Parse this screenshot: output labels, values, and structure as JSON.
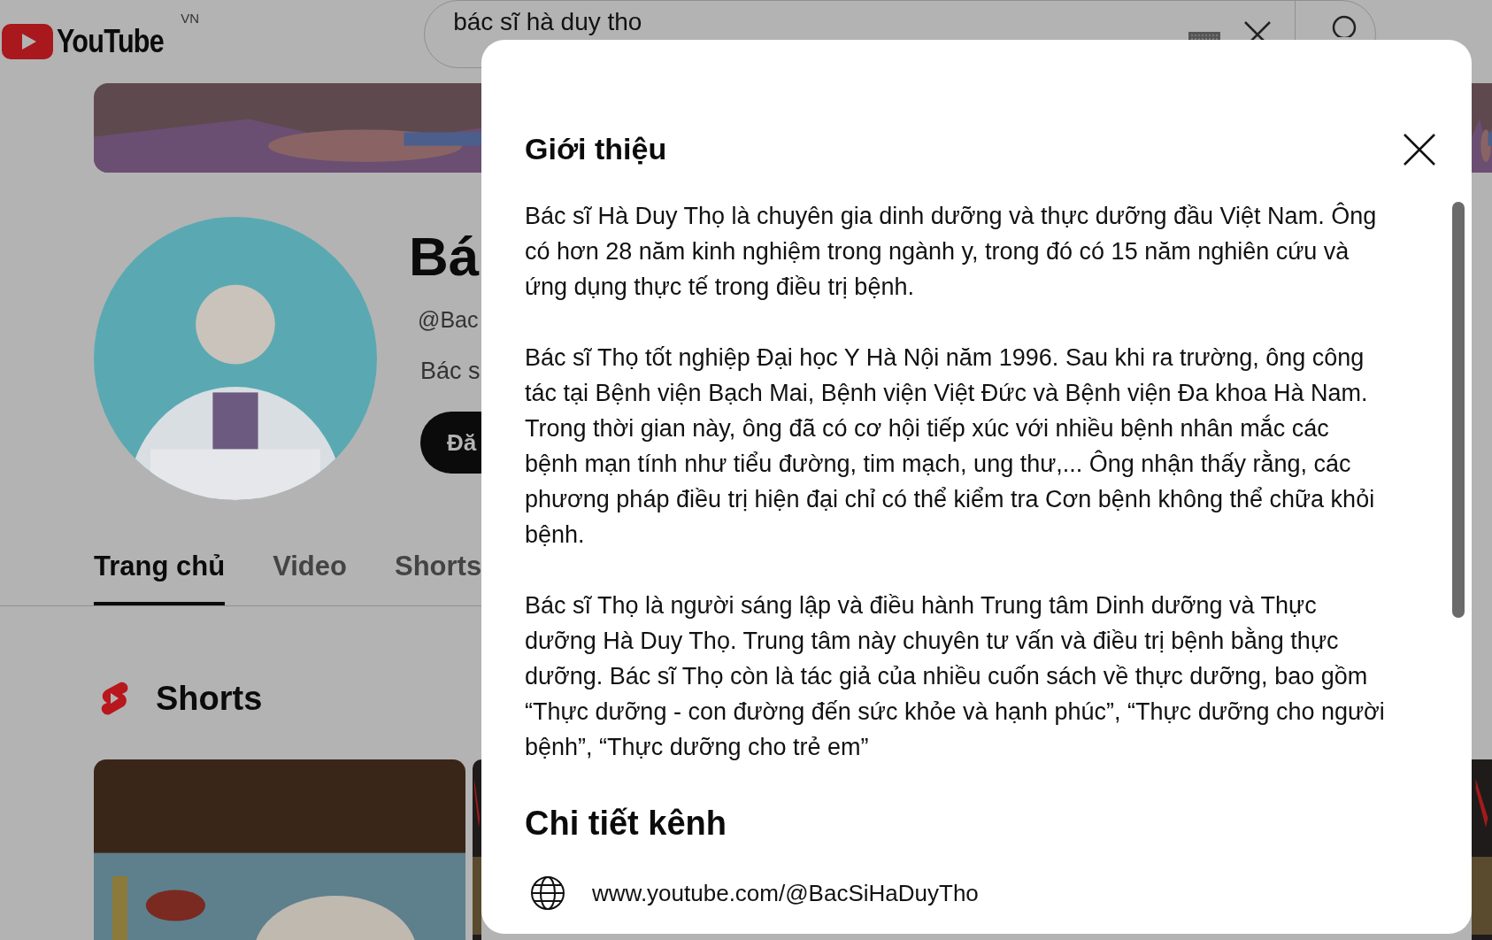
{
  "header": {
    "logo_text": "YouTube",
    "region": "VN",
    "search": {
      "value": "bác sĩ hà duy tho"
    }
  },
  "channel": {
    "name": "Bá",
    "handle": "@Bac",
    "description": "Bác s",
    "subscribe_button": "Đă"
  },
  "tabs": [
    {
      "label": "Trang chủ",
      "selected": true
    },
    {
      "label": "Video",
      "selected": false
    },
    {
      "label": "Shorts",
      "selected": false
    }
  ],
  "shorts_section": {
    "title": "Shorts"
  },
  "about_dialog": {
    "title": "Giới thiệu",
    "paragraphs": [
      "Bác sĩ Hà Duy Thọ là chuyên gia dinh dưỡng và thực dưỡng đầu Việt Nam. Ông có hơn 28 năm kinh nghiệm trong ngành y, trong đó có 15 năm nghiên cứu và ứng dụng thực tế trong điều trị bệnh.",
      "Bác sĩ Thọ tốt nghiệp Đại học Y Hà Nội năm 1996. Sau khi ra trường, ông công tác tại Bệnh viện Bạch Mai, Bệnh viện Việt Đức và Bệnh viện Đa khoa Hà Nam. Trong thời gian này, ông đã có cơ hội tiếp xúc với nhiều bệnh nhân mắc các bệnh mạn tính như tiểu đường, tim mạch, ung thư,... Ông nhận thấy rằng, các phương pháp điều trị hiện đại chỉ có thể kiểm tra Cơn bệnh không thể chữa khỏi bệnh.",
      "Bác sĩ Thọ là người sáng lập và điều hành Trung tâm Dinh dưỡng và Thực dưỡng Hà Duy Thọ. Trung tâm này chuyên tư vấn và điều trị bệnh bằng thực dưỡng. Bác sĩ Thọ còn là tác giả của nhiều cuốn sách về thực dưỡng, bao gồm “Thực dưỡng - con đường đến sức khỏe và hạnh phúc”, “Thực dưỡng cho người bệnh”, “Thực dưỡng cho trẻ em”"
    ],
    "details_title": "Chi tiết kênh",
    "details": [
      {
        "kind": "link",
        "text": "www.youtube.com/@BacSiHaDuyTho"
      }
    ]
  }
}
